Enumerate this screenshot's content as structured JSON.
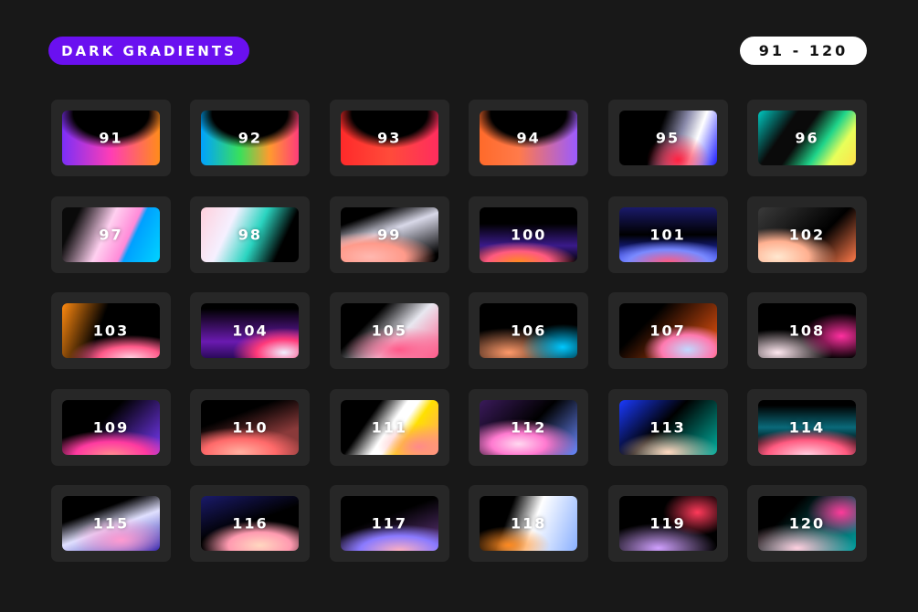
{
  "header": {
    "title": "DARK GRADIENTS",
    "range": "91 - 120"
  },
  "colors": {
    "background": "#181818",
    "card": "#272727",
    "title_pill": "#6a10f0",
    "range_pill": "#ffffff"
  },
  "swatches": [
    {
      "label": "91"
    },
    {
      "label": "92"
    },
    {
      "label": "93"
    },
    {
      "label": "94"
    },
    {
      "label": "95"
    },
    {
      "label": "96"
    },
    {
      "label": "97"
    },
    {
      "label": "98"
    },
    {
      "label": "99"
    },
    {
      "label": "100"
    },
    {
      "label": "101"
    },
    {
      "label": "102"
    },
    {
      "label": "103"
    },
    {
      "label": "104"
    },
    {
      "label": "105"
    },
    {
      "label": "106"
    },
    {
      "label": "107"
    },
    {
      "label": "108"
    },
    {
      "label": "109"
    },
    {
      "label": "110"
    },
    {
      "label": "111"
    },
    {
      "label": "112"
    },
    {
      "label": "113"
    },
    {
      "label": "114"
    },
    {
      "label": "115"
    },
    {
      "label": "116"
    },
    {
      "label": "117"
    },
    {
      "label": "118"
    },
    {
      "label": "119"
    },
    {
      "label": "120"
    }
  ]
}
